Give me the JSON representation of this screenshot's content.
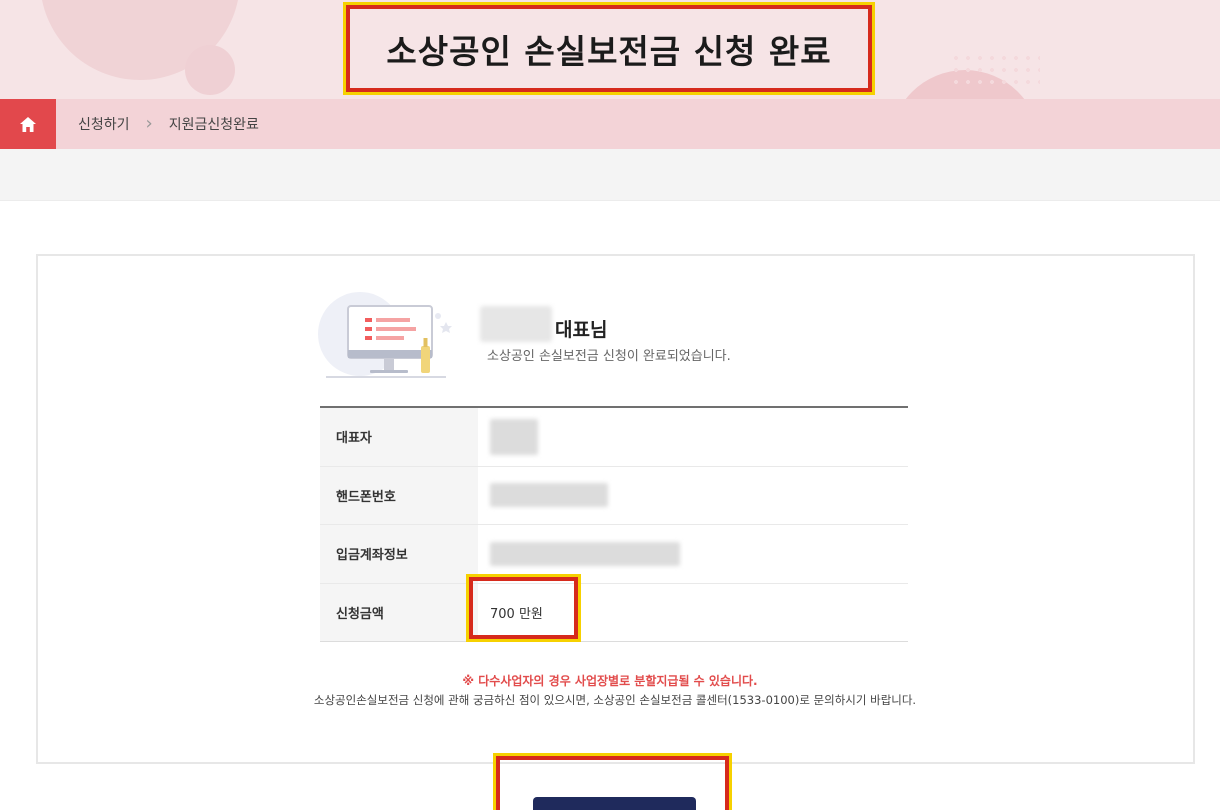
{
  "header": {
    "title": "소상공인 손실보전금 신청 완료"
  },
  "breadcrumb": {
    "items": [
      "신청하기",
      "지원금신청완료"
    ],
    "separator": "›"
  },
  "result": {
    "name_suffix": "대표님",
    "message": "소상공인 손실보전금 신청이 완료되었습니다."
  },
  "table": {
    "rows": [
      {
        "label": "대표자",
        "value": ""
      },
      {
        "label": "핸드폰번호",
        "value": ""
      },
      {
        "label": "입금계좌정보",
        "value": ""
      },
      {
        "label": "신청금액",
        "value": "700 만원"
      }
    ]
  },
  "notices": {
    "red": "※ 다수사업자의 경우 사업장별로 분할지급될 수 있습니다.",
    "grey": "소상공인손실보전금 신청에 관해 궁금하신 점이 있으시면, 소상공인 손실보전금 콜센터(1533-0100)로 문의하시기 바랍니다."
  },
  "colors": {
    "highlight_border": "#d62a1c",
    "highlight_outline": "#f6d100",
    "home_button": "#e2484c",
    "breadcrumb_bg": "#f3d3d7",
    "notice_red": "#e24c4c",
    "confirm_button": "#1f2a5c"
  },
  "icons": {
    "home": "home-icon",
    "illustration": "monitor-illustration"
  }
}
